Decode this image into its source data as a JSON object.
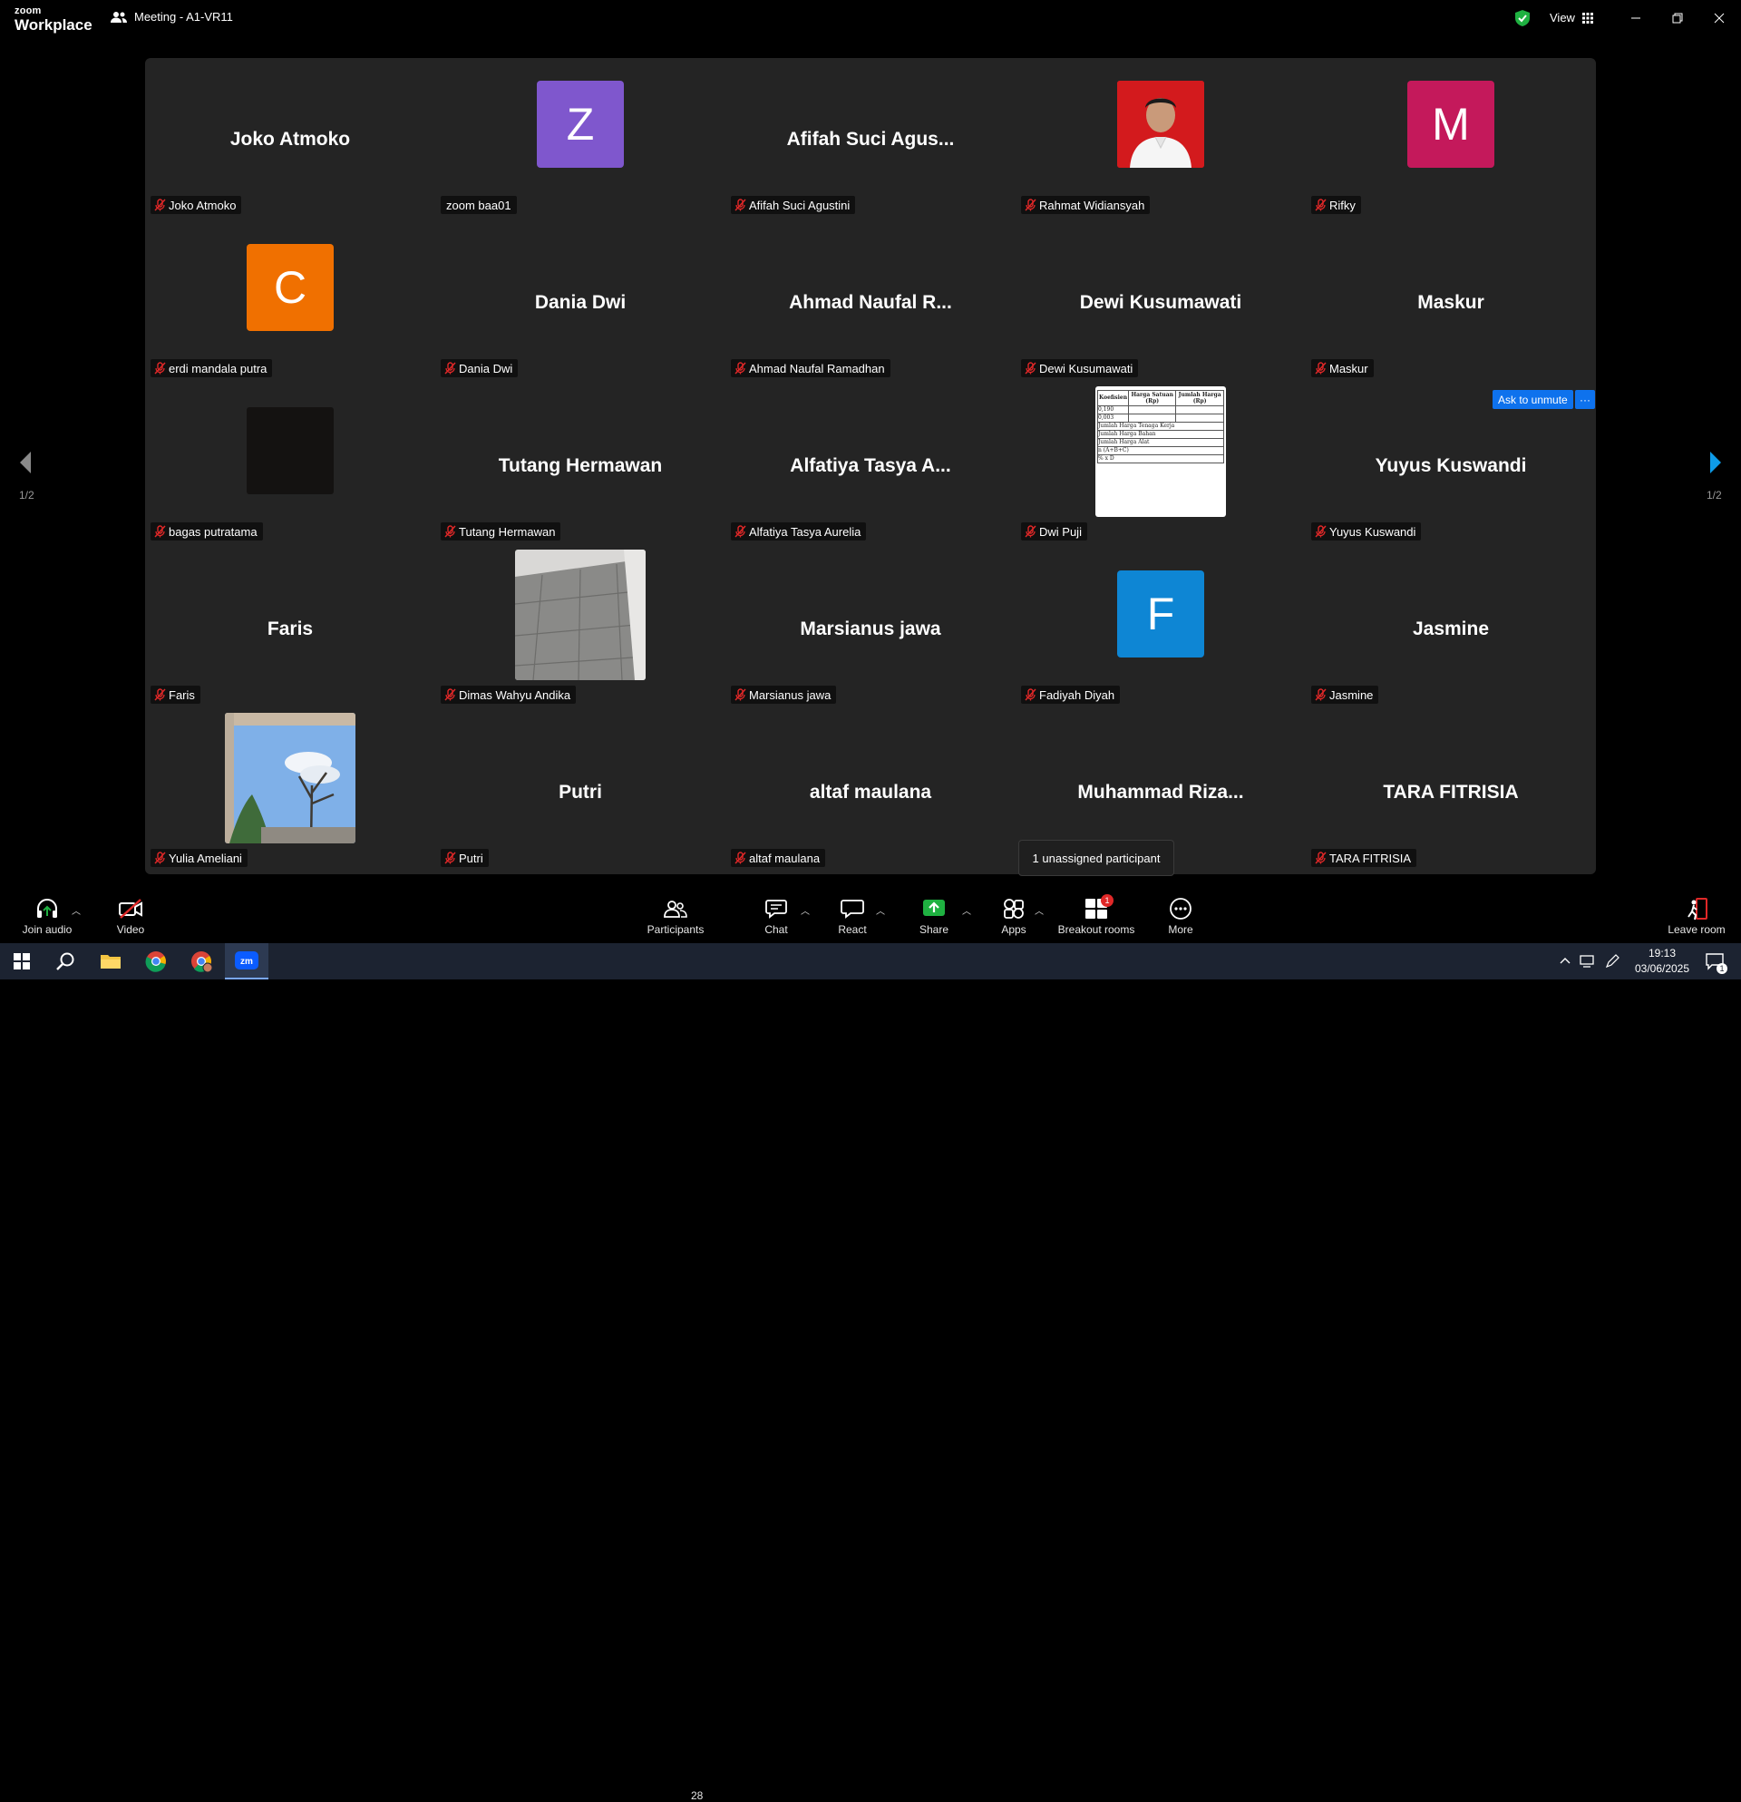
{
  "app": {
    "brand_top": "zoom",
    "brand_bottom": "Workplace",
    "meeting_title": "Meeting - A1-VR11",
    "view_label": "View"
  },
  "participants": [
    {
      "label": "Joko Atmoko",
      "display": "Joko Atmoko",
      "type": "name",
      "muted": true
    },
    {
      "label": "zoom baa01",
      "display": "Z",
      "type": "avatar",
      "color": "#7f57cd",
      "muted": false
    },
    {
      "label": "Afifah Suci Agustini",
      "display": "Afifah  Suci  Agus...",
      "type": "name",
      "muted": true
    },
    {
      "label": "Rahmat Widiansyah",
      "display": "",
      "type": "photo-portrait",
      "muted": true
    },
    {
      "label": "Rifky",
      "display": "M",
      "type": "avatar",
      "color": "#c4195b",
      "muted": true
    },
    {
      "label": "erdi mandala putra",
      "display": "C",
      "type": "avatar",
      "color": "#f07000",
      "muted": true
    },
    {
      "label": "Dania Dwi",
      "display": "Dania Dwi",
      "type": "name",
      "muted": true
    },
    {
      "label": "Ahmad Naufal Ramadhan",
      "display": "Ahmad  Naufal  R...",
      "type": "name",
      "muted": true
    },
    {
      "label": "Dewi Kusumawati",
      "display": "Dewi Kusumawati",
      "type": "name",
      "muted": true
    },
    {
      "label": "Maskur",
      "display": "Maskur",
      "type": "name",
      "muted": true
    },
    {
      "label": "bagas putratama",
      "display": "",
      "type": "photo-dark",
      "muted": true
    },
    {
      "label": "Tutang Hermawan",
      "display": "Tutang Hermawan",
      "type": "name",
      "muted": true
    },
    {
      "label": "Alfatiya Tasya Aurelia",
      "display": "Alfatiya  Tasya  A...",
      "type": "name",
      "muted": true
    },
    {
      "label": "Dwi Puji",
      "display": "",
      "type": "photo-document",
      "muted": true
    },
    {
      "label": "Yuyus Kuswandi",
      "display": "Yuyus Kuswandi",
      "type": "name",
      "muted": true
    },
    {
      "label": "Faris",
      "display": "Faris",
      "type": "name",
      "muted": true
    },
    {
      "label": "Dimas Wahyu Andika",
      "display": "",
      "type": "photo-floor",
      "muted": true
    },
    {
      "label": "Marsianus jawa",
      "display": "Marsianus jawa",
      "type": "name",
      "muted": true
    },
    {
      "label": "Fadiyah Diyah",
      "display": "F",
      "type": "avatar",
      "color": "#0e86d4",
      "muted": true
    },
    {
      "label": "Jasmine",
      "display": "Jasmine",
      "type": "name",
      "muted": true
    },
    {
      "label": "Yulia Ameliani",
      "display": "",
      "type": "photo-sky",
      "muted": true
    },
    {
      "label": "Putri",
      "display": "Putri",
      "type": "name",
      "muted": true
    },
    {
      "label": "altaf maulana",
      "display": "altaf maulana",
      "type": "name",
      "muted": true
    },
    {
      "label": "",
      "display": "Muhammad  Riza...",
      "type": "name",
      "muted": false
    },
    {
      "label": "TARA FITRISIA",
      "display": "TARA FITRISIA",
      "type": "name",
      "muted": true
    }
  ],
  "document_preview": {
    "headers": [
      "Koefisien",
      "Harga Satuan (Rp)",
      "Jumlah Harga (Rp)"
    ],
    "rows": [
      "0,190",
      "0,003",
      "Jumlah Harga Tenaga Kerja",
      "Jumlah Harga Bahan",
      "Jumlah Harga Alat",
      "n (A+B+C)",
      "% x D"
    ]
  },
  "controls": {
    "ask_to_unmute": "Ask to unmute",
    "more_dots": "···"
  },
  "pagination": {
    "left": "1/2",
    "right": "1/2"
  },
  "tooltip": "1 unassigned participant",
  "toolbar": {
    "join_audio": "Join audio",
    "video": "Video",
    "participants": "Participants",
    "participants_count": "28",
    "chat": "Chat",
    "react": "React",
    "share": "Share",
    "apps": "Apps",
    "breakout": "Breakout rooms",
    "breakout_badge": "1",
    "more": "More",
    "leave": "Leave room"
  },
  "taskbar": {
    "time": "19:13",
    "date": "03/06/2025",
    "notif_count": "1"
  },
  "colors": {
    "accent": "#0e72ed",
    "muted_red": "#e02828",
    "share_green": "#1fb141",
    "gallery_bg": "#242424"
  }
}
